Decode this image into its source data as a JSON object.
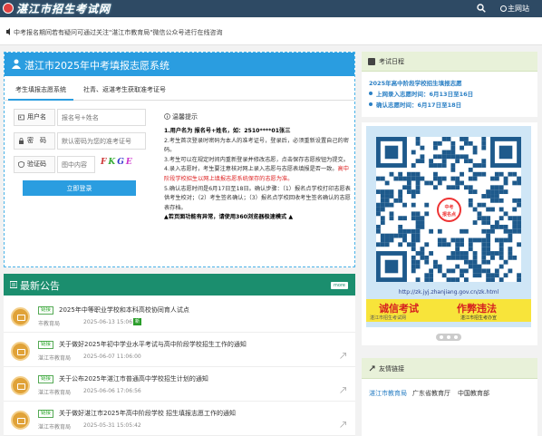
{
  "header": {
    "logo_text": "湛江市招生考试网",
    "home_label": "主网站"
  },
  "notice": {
    "text": "中考报名期间若有疑问可通过关注\"湛江市教育局\"微信公众号进行在线咨询"
  },
  "login": {
    "title": "湛江市2025年中考填报志愿系统",
    "tabs": [
      "考生填报志愿系统",
      "社青、返湛考生获取准考证号"
    ],
    "username_label": "用户名",
    "username_placeholder": "报名号+姓名",
    "password_label": "密　码",
    "password_placeholder": "默认密码为您的准考证号",
    "captcha_label": "验证码",
    "captcha_placeholder": "图中内容",
    "captcha_chars": [
      "F",
      "K",
      "G",
      "E"
    ],
    "login_button": "立即登录",
    "hint_title": "温馨提示",
    "hints": {
      "h1": "1.用户名为 报名号+姓名，如：2510****01张三",
      "h2": "2.考生首次登录时密码为本人的准考证号，登录后，必须重新设置自己的密码。",
      "h3": "3.考生可以在规定时间内重新登录并修改志愿，点击保存志愿按钮为提交。",
      "h4a": "4.录入志愿时，考生要注意核对网上录入志愿与志愿表填报是否一致。",
      "h4b": "高中阶段学校招生以网上填报志愿系统保存的志愿为准。",
      "h5": "5.确认志愿时间是6月17日至18日。确认步骤：（1）报名点学校打印志愿表供考生校对；（2）考生签名确认；（3）报名点学校回收考生签名确认的志愿表存档。",
      "h6": "▲若页面功能有异常，请使用360浏览器极速模式 ▲"
    }
  },
  "announcements": {
    "title": "最新公告",
    "more_label": "more",
    "items": [
      {
        "tag": "链接",
        "title": "2025年中等职业学校和本科高校协同育人试点",
        "source": "市教育局",
        "date": "2025-06-13 15:06:33",
        "new": true
      },
      {
        "tag": "链接",
        "title": "关于做好2025年初中学业水平考试与高中阶段学校招生工作的通知",
        "source": "湛江市教育局",
        "date": "2025-06-07 11:06:00",
        "new": false
      },
      {
        "tag": "链接",
        "title": "关于公布2025年湛江市普通高中学校招生计划的通知",
        "source": "湛江市教育局",
        "date": "2025-06-06 17:06:56",
        "new": false
      },
      {
        "tag": "链接",
        "title": "关于做好湛江市2025年高中阶段学校 招生填报志愿工作的通知",
        "source": "湛江市教育局",
        "date": "2025-05-31 15:05:42",
        "new": false
      }
    ],
    "new_label": "新"
  },
  "schedule": {
    "title": "考试日程",
    "headline": "2025年高中阶段学校招生填报志愿",
    "lines": [
      "上网录入志愿时间：6月13日至16日",
      "确认志愿时间：6月17日至18日"
    ]
  },
  "poster": {
    "badge_line1": "中考",
    "badge_line2": "报名点",
    "url": "http://zk.jyj.zhanjiang.gov.cn/zk.html",
    "slogan_left": "诚信考试",
    "slogan_right": "作弊违法",
    "slogan_sub": "湛江市招生考办宣",
    "site": "湛江市招生考试网"
  },
  "links": {
    "title": "友情链接",
    "items": [
      {
        "label": "湛江市教育局",
        "color": "#2a7fc4"
      },
      {
        "label": "广东省教育厅",
        "color": "#333333"
      },
      {
        "label": "中国教育部",
        "color": "#333333"
      }
    ]
  },
  "colors": {
    "topbar": "#2e4a64",
    "login_accent": "#2a9de0",
    "announcement_accent": "#1b8e6e",
    "schedule_text": "#2a7fc4"
  }
}
